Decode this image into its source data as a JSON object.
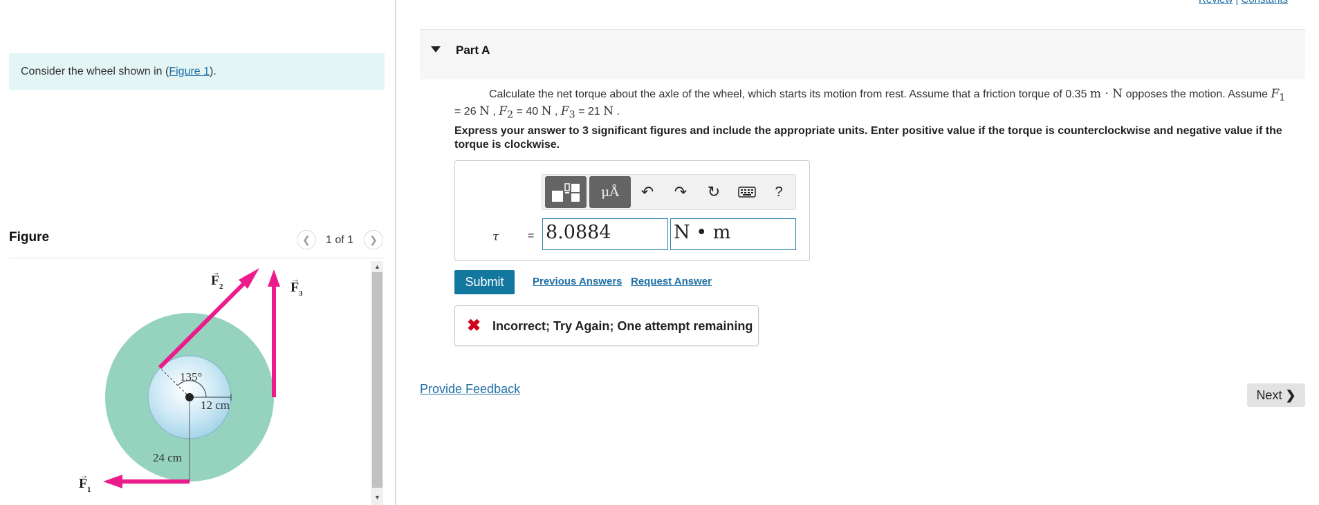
{
  "intro": {
    "prefix": "Consider the wheel shown in (",
    "link": "Figure 1",
    "suffix": ")."
  },
  "figure_panel": {
    "heading": "Figure",
    "pager": "1 of 1",
    "labels": {
      "angle": "135°",
      "inner_radius": "12 cm",
      "outer_radius": "24 cm",
      "f1": "F",
      "f1_sub": "1",
      "f2": "F",
      "f2_sub": "2",
      "f3": "F",
      "f3_sub": "3"
    },
    "colors": {
      "wheel": "#95d3be",
      "hub": "#cfeaf6",
      "arrow": "#ec1c8c"
    }
  },
  "top_links": {
    "review": "Review",
    "separator": "|",
    "constants": "Constants"
  },
  "part": {
    "title": "Part A"
  },
  "question": {
    "text1": "Calculate the net torque about the axle of the wheel, which starts its motion from rest. Assume that a friction torque of 0.35",
    "friction_units": "m · N",
    "text2": "opposes the motion. Assume",
    "f1_sym": "F",
    "f1_sub": "1",
    "f1_val": "= 26",
    "f2_sym": "F",
    "f2_sub": "2",
    "f2_val": "= 40",
    "f3_sym": "F",
    "f3_sub": "3",
    "f3_val": "= 21",
    "unit_n": "N",
    "comma": ",",
    "period": "."
  },
  "instructions": "Express your answer to 3 significant figures and include the appropriate units. Enter positive value if the torque is counterclockwise and negative value if the torque is clockwise.",
  "answer": {
    "variable": "τ",
    "equals": "=",
    "value": "8.0884",
    "units": "N • m",
    "toolbar": {
      "templates_icon": "templates-icon",
      "units_label": "μÅ",
      "undo": "↶",
      "redo": "↷",
      "reset": "↻",
      "keyboard_icon": "keyboard-icon",
      "help": "?"
    }
  },
  "actions": {
    "submit": "Submit",
    "previous_answers": "Previous Answers",
    "request_answer": "Request Answer"
  },
  "feedback": {
    "icon": "✖",
    "text": "Incorrect; Try Again; One attempt remaining"
  },
  "footer": {
    "provide_feedback": "Provide Feedback",
    "next": "Next"
  }
}
